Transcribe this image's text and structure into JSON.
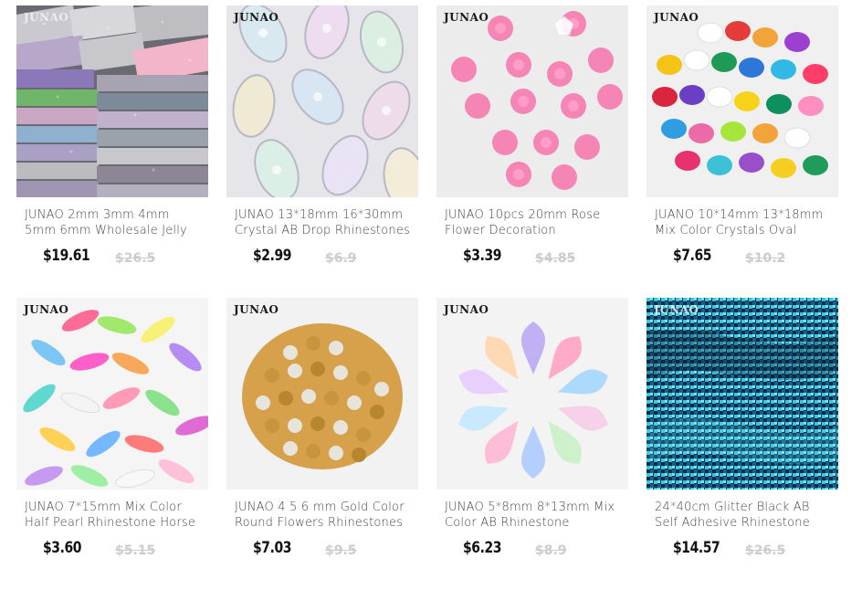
{
  "products": [
    {
      "brand": "JUNAO",
      "title": "JUNAO 2mm 3mm 4mm 5mm 6mm Wholesale Jelly",
      "price": "$19.61",
      "old_price": "$26.5",
      "image": "bags-of-glitter-rhinestones"
    },
    {
      "brand": "JUNAO",
      "title": "JUNAO 13*18mm 16*30mm Crystal AB Drop Rhinestones",
      "price": "$2.99",
      "old_price": "$6.9",
      "image": "crystal-ab-drop-rhinestones"
    },
    {
      "brand": "JUNAO",
      "title": "JUNAO 10pcs 20mm Rose Flower Decoration",
      "price": "$3.39",
      "old_price": "$4.85",
      "image": "pink-rose-flowers"
    },
    {
      "brand": "JUNAO",
      "title": "JUANO 10*14mm 13*18mm Mix Color Crystals Oval",
      "price": "$7.65",
      "old_price": "$10.2",
      "image": "mixed-color-oval-crystals"
    },
    {
      "brand": "JUNAO",
      "title": "JUNAO 7*15mm Mix Color Half Pearl Rhinestone Horse",
      "price": "$3.60",
      "old_price": "$5.15",
      "image": "horse-eye-half-pearls"
    },
    {
      "brand": "JUNAO",
      "title": "JUNAO 4 5 6 mm Gold Color Round Flowers Rhinestones",
      "price": "$7.03",
      "old_price": "$9.5",
      "image": "gold-round-flower-rhinestones"
    },
    {
      "brand": "JUNAO",
      "title": "JUNAO 5*8mm 8*13mm Mix Color AB Rhinestone",
      "price": "$6.23",
      "old_price": "$8.9",
      "image": "teardrop-ab-rhinestone-circle"
    },
    {
      "brand": "JUNAO",
      "title": "24*40cm Glitter Black AB Self Adhesive Rhinestone",
      "price": "$14.57",
      "old_price": "$26.5",
      "image": "black-ab-glitter-sheet"
    }
  ],
  "colors": {
    "price": "#111111",
    "old_price": "#cccccc",
    "title": "#444444"
  }
}
